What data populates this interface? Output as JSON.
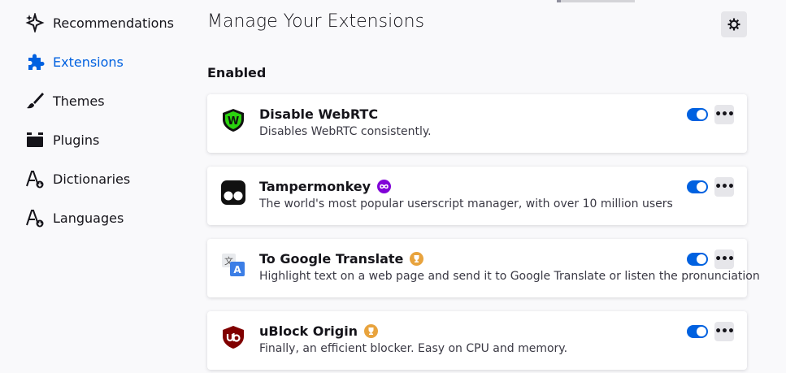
{
  "sidebar": {
    "items": [
      {
        "label": "Recommendations",
        "icon": "sparkle-icon"
      },
      {
        "label": "Extensions",
        "icon": "puzzle-icon",
        "active": true
      },
      {
        "label": "Themes",
        "icon": "brush-icon"
      },
      {
        "label": "Plugins",
        "icon": "plugin-icon"
      },
      {
        "label": "Dictionaries",
        "icon": "dictionary-icon"
      },
      {
        "label": "Languages",
        "icon": "language-icon"
      }
    ]
  },
  "main": {
    "title": "Manage Your Extensions",
    "section": "Enabled",
    "more_glyph": "•••",
    "extensions": [
      {
        "name": "Disable WebRTC",
        "description": "Disables WebRTC consistently.",
        "icon": "shield-w-icon",
        "badge": null,
        "enabled": true
      },
      {
        "name": "Tampermonkey",
        "description": "The world's most popular userscript manager, with over 10 million users",
        "icon": "tampermonkey-icon",
        "badge": "infinity-badge-icon",
        "enabled": true
      },
      {
        "name": "To Google Translate",
        "description": "Highlight text on a web page and send it to Google Translate or listen the pronunciation",
        "icon": "translate-icon",
        "badge": "trophy-badge-icon",
        "enabled": true
      },
      {
        "name": "uBlock Origin",
        "description": "Finally, an efficient blocker. Easy on CPU and memory.",
        "icon": "ublock-icon",
        "badge": "trophy-badge-icon",
        "enabled": true
      }
    ]
  },
  "colors": {
    "accent": "#0061e0",
    "badge_purple": "#8000d7",
    "badge_gold": "#e8a33d"
  }
}
